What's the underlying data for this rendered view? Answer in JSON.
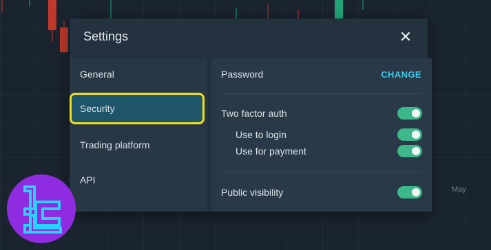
{
  "chart": {
    "month_label": "May"
  },
  "settings": {
    "title": "Settings",
    "close_glyph": "✕",
    "nav": [
      {
        "label": "General"
      },
      {
        "label": "Security"
      },
      {
        "label": "Trading platform"
      },
      {
        "label": "API"
      }
    ],
    "active_nav": "Security",
    "password": {
      "label": "Password",
      "action": "CHANGE"
    },
    "two_factor": {
      "label": "Two factor auth",
      "enabled": true,
      "use_to_login": {
        "label": "Use to login",
        "enabled": true
      },
      "use_for_payment": {
        "label": "Use for payment",
        "enabled": true
      }
    },
    "public_visibility": {
      "label": "Public visibility",
      "enabled": true
    }
  },
  "colors": {
    "accent": "#3ec6e6",
    "toggle_on": "#3cb88a",
    "highlight": "#f2e11a",
    "active_nav_bg": "#1f5569",
    "logo_bg": "#8f2be0",
    "logo_fg": "#27d3ff"
  },
  "icons": {
    "close": "close-icon",
    "logo": "brand-logo-icon"
  }
}
